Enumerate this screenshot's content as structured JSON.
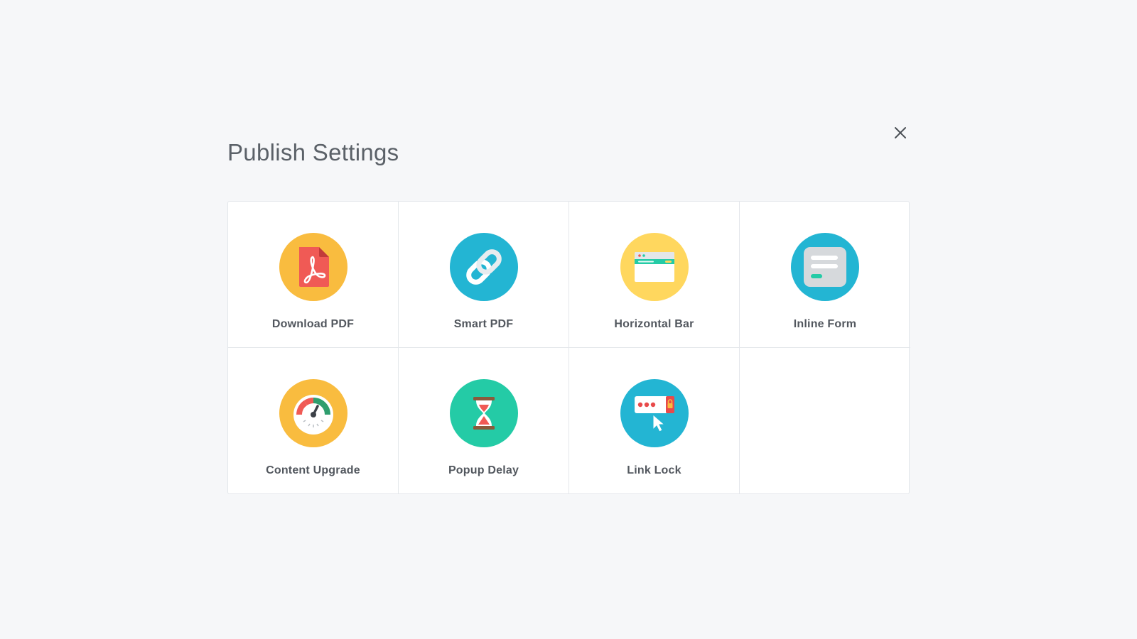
{
  "dialog": {
    "title": "Publish Settings",
    "close_icon": "close-icon"
  },
  "options": [
    {
      "label": "Download PDF",
      "icon": "pdf-file-icon",
      "color": "#f9bc3f"
    },
    {
      "label": "Smart PDF",
      "icon": "chain-link-icon",
      "color": "#23b5d3"
    },
    {
      "label": "Horizontal Bar",
      "icon": "browser-bar-icon",
      "color": "#ffd75e"
    },
    {
      "label": "Inline Form",
      "icon": "inline-form-icon",
      "color": "#23b5d3"
    },
    {
      "label": "Content Upgrade",
      "icon": "gauge-icon",
      "color": "#f9bc3f"
    },
    {
      "label": "Popup Delay",
      "icon": "hourglass-icon",
      "color": "#24cba6"
    },
    {
      "label": "Link Lock",
      "icon": "password-lock-icon",
      "color": "#23b5d3"
    }
  ]
}
